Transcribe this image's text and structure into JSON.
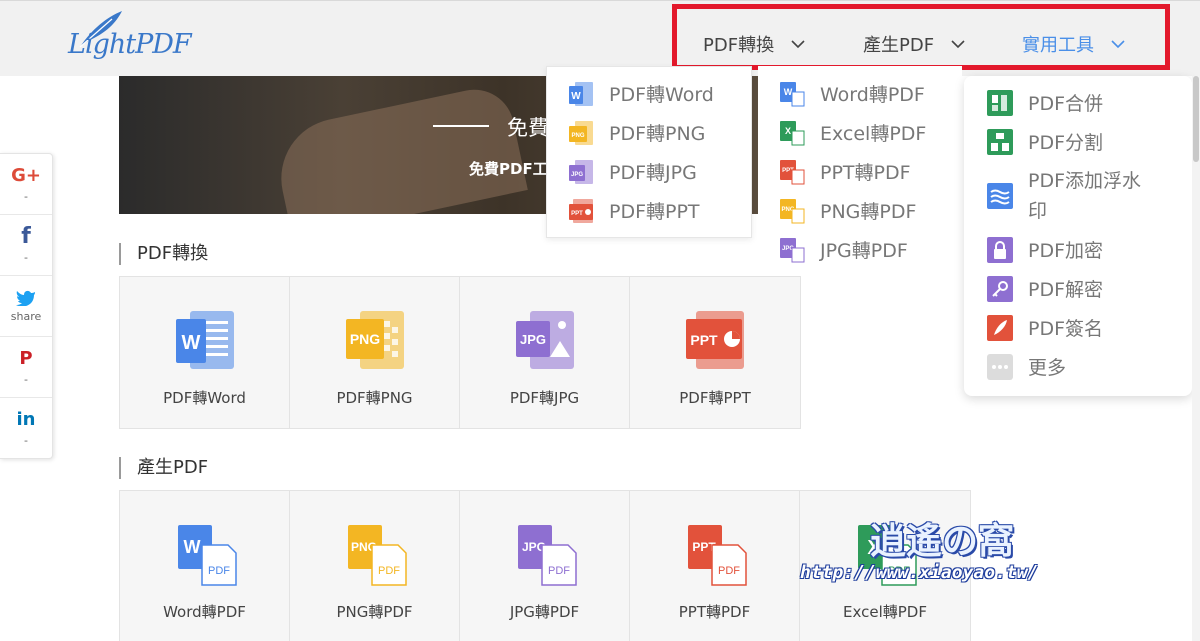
{
  "brand": {
    "logo_text": "LightPDF"
  },
  "nav": {
    "items": [
      {
        "label": "PDF轉換"
      },
      {
        "label": "產生PDF"
      },
      {
        "label": "實用工具"
      }
    ]
  },
  "banner": {
    "title": "免費",
    "subtitle": "免費PDF工"
  },
  "social": [
    {
      "icon": "G+",
      "count": "-",
      "color": "#dd4b39"
    },
    {
      "icon": "f",
      "count": "-",
      "color": "#3b5998"
    },
    {
      "icon": "t",
      "count": "share",
      "color": "#1da1f2"
    },
    {
      "icon": "P",
      "count": "-",
      "color": "#cb2027"
    },
    {
      "icon": "in",
      "count": "-",
      "color": "#0077b5"
    }
  ],
  "sections": {
    "convert": {
      "title": "PDF轉換",
      "cards": [
        {
          "label": "PDF轉Word",
          "tag": "W",
          "color": "#4a86e8"
        },
        {
          "label": "PDF轉PNG",
          "tag": "PNG",
          "color": "#f3b623"
        },
        {
          "label": "PDF轉JPG",
          "tag": "JPG",
          "color": "#8e6fd1"
        },
        {
          "label": "PDF轉PPT",
          "tag": "PPT",
          "color": "#e2523b"
        }
      ]
    },
    "create": {
      "title": "產生PDF",
      "cards": [
        {
          "label": "Word轉PDF",
          "tag": "W",
          "color": "#4a86e8"
        },
        {
          "label": "PNG轉PDF",
          "tag": "PNG",
          "color": "#f3b623"
        },
        {
          "label": "JPG轉PDF",
          "tag": "JPG",
          "color": "#8e6fd1"
        },
        {
          "label": "PPT轉PDF",
          "tag": "PPT",
          "color": "#e2523b"
        },
        {
          "label": "Excel轉PDF",
          "tag": "X",
          "color": "#2e9b5a"
        }
      ]
    }
  },
  "dropdown_convert": [
    {
      "label": "PDF轉Word",
      "tag": "W",
      "color": "#4a86e8"
    },
    {
      "label": "PDF轉PNG",
      "tag": "PNG",
      "color": "#f3b623"
    },
    {
      "label": "PDF轉JPG",
      "tag": "JPG",
      "color": "#8e6fd1"
    },
    {
      "label": "PDF轉PPT",
      "tag": "PPT",
      "color": "#e2523b"
    }
  ],
  "dropdown_create": [
    {
      "label": "Word轉PDF",
      "tag": "W",
      "color": "#4a86e8"
    },
    {
      "label": "Excel轉PDF",
      "tag": "X",
      "color": "#2e9b5a"
    },
    {
      "label": "PPT轉PDF",
      "tag": "PPT",
      "color": "#e2523b"
    },
    {
      "label": "PNG轉PDF",
      "tag": "PNG",
      "color": "#f3b623"
    },
    {
      "label": "JPG轉PDF",
      "tag": "JPG",
      "color": "#8e6fd1"
    }
  ],
  "dropdown_tools": [
    {
      "label": "PDF合併",
      "icon": "merge-icon",
      "color": "#2e9b5a"
    },
    {
      "label": "PDF分割",
      "icon": "split-icon",
      "color": "#2e9b5a"
    },
    {
      "label": "PDF添加浮水",
      "label2": "印",
      "icon": "watermark-icon",
      "color": "#4a86e8"
    },
    {
      "label": "PDF加密",
      "icon": "lock-icon",
      "color": "#8e6fd1"
    },
    {
      "label": "PDF解密",
      "icon": "key-icon",
      "color": "#8e6fd1"
    },
    {
      "label": "PDF簽名",
      "icon": "pen-icon",
      "color": "#e2523b"
    },
    {
      "label": "更多",
      "icon": "more-icon",
      "color": "#d8d8d8"
    }
  ],
  "watermark": {
    "main": "逍遙の窩",
    "url": "http://www.xiaoyao.tw/"
  },
  "colors": {
    "accent": "#4a8fe8",
    "highlight": "#e3192c"
  }
}
